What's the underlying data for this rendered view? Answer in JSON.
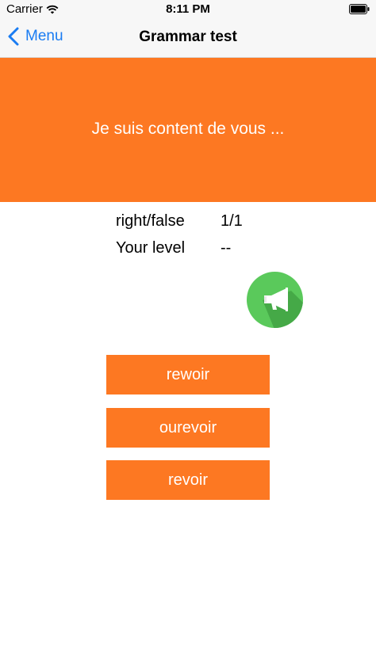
{
  "status_bar": {
    "carrier": "Carrier",
    "time": "8:11 PM"
  },
  "nav": {
    "back_label": "Menu",
    "title": "Grammar test"
  },
  "question": {
    "text": "Je suis content de vous ..."
  },
  "stats": {
    "score_label": "right/false",
    "score_value": "1/1",
    "level_label": "Your level",
    "level_value": "--"
  },
  "answers": [
    {
      "label": "rewoir"
    },
    {
      "label": "ourevoir"
    },
    {
      "label": "revoir"
    }
  ],
  "colors": {
    "accent": "#fd7822",
    "link": "#1a7cf2",
    "speaker": "#5ac95b"
  },
  "icons": {
    "speaker": "megaphone-icon",
    "back": "chevron-left-icon"
  }
}
